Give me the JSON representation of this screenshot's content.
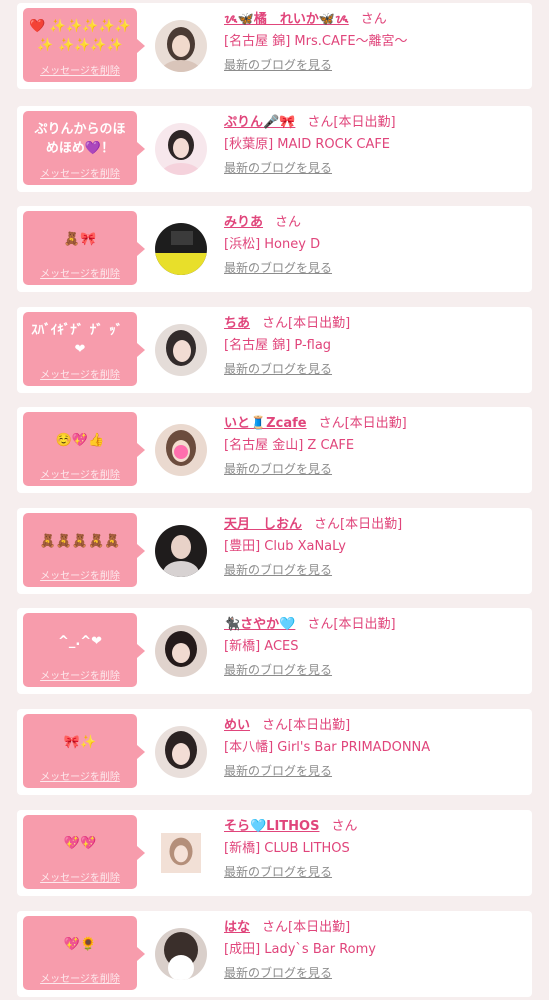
{
  "colors": {
    "accent": "#e0457b",
    "bubble": "#f79cac",
    "background": "#f6eeee"
  },
  "entries": [
    {
      "bubble": "❤️ ✨✨✨✨✨✨ ✨✨✨✨",
      "delete_label": "メッセージを削除",
      "name": "ᝰ🦋橘　れいか🦋ᝰ",
      "suffix": "さん",
      "shop": "[名古屋 錦] Mrs.CAFE〜離宮〜",
      "blog_label": "最新のブログを見る",
      "avatar_colors": [
        "#e9ddd6",
        "#4a3a33"
      ]
    },
    {
      "bubble": "ぷりんからのほめほめ💜！",
      "delete_label": "メッセージを削除",
      "name": "ぷりん🎤🎀",
      "suffix": "さん[本日出勤]",
      "shop": "[秋葉原] MAID ROCK CAFE",
      "blog_label": "最新のブログを見る",
      "avatar_colors": [
        "#f7e7ec",
        "#2e2626"
      ]
    },
    {
      "bubble": "🧸🎀",
      "delete_label": "メッセージを削除",
      "name": "みりあ",
      "suffix": "さん",
      "shop": "[浜松] Honey D",
      "blog_label": "最新のブログを見る",
      "avatar_colors": [
        "#e8df2a",
        "#1d1d1d"
      ]
    },
    {
      "bubble": "ｽﾊﾞｲｷﾞﾅ゛ﾅ゛ｯ゛❤",
      "delete_label": "メッセージを削除",
      "name": "ちあ",
      "suffix": "さん[本日出勤]",
      "shop": "[名古屋 錦] P-flag",
      "blog_label": "最新のブログを見る",
      "avatar_colors": [
        "#e4dcd8",
        "#322b2b"
      ]
    },
    {
      "bubble": "☺️💖👍",
      "delete_label": "メッセージを削除",
      "name": "いと🧵Zcafe",
      "suffix": "さん[本日出勤]",
      "shop": "[名古屋 金山] Z CAFE",
      "blog_label": "最新のブログを見る",
      "avatar_colors": [
        "#ead9cf",
        "#6b4c3d"
      ]
    },
    {
      "bubble": "🧸🧸🧸🧸🧸",
      "delete_label": "メッセージを削除",
      "name": "天月　しおん",
      "suffix": "さん[本日出勤]",
      "shop": "[豊田] Club XaNaLy",
      "blog_label": "最新のブログを見る",
      "avatar_colors": [
        "#d7d2d2",
        "#1f1c1c"
      ]
    },
    {
      "bubble": "^_.^❤",
      "delete_label": "メッセージを削除",
      "name": "🐈‍⬛さやか🩵",
      "suffix": "さん[本日出勤]",
      "shop": "[新橋] ACES",
      "blog_label": "最新のブログを見る",
      "avatar_colors": [
        "#e0d3cd",
        "#241a1a"
      ]
    },
    {
      "bubble": "🎀✨",
      "delete_label": "メッセージを削除",
      "name": "めい",
      "suffix": "さん[本日出勤]",
      "shop": "[本八幡] Girl's Bar PRIMADONNA",
      "blog_label": "最新のブログを見る",
      "avatar_colors": [
        "#e9dfdb",
        "#2b2222"
      ]
    },
    {
      "bubble": "💖💖",
      "delete_label": "メッセージを削除",
      "name": "そら🩵LITHOS",
      "suffix": "さん",
      "shop": "[新橋] CLUB LITHOS",
      "blog_label": "最新のブログを見る",
      "avatar_colors": [
        "#f2e0d6",
        "#b48f7a"
      ]
    },
    {
      "bubble": "💖🌻",
      "delete_label": "メッセージを削除",
      "name": "はな",
      "suffix": "さん[本日出勤]",
      "shop": "[成田] Lady`s Bar Romy",
      "blog_label": "最新のブログを見る",
      "avatar_colors": [
        "#d9cfca",
        "#3a2f2b"
      ]
    }
  ]
}
